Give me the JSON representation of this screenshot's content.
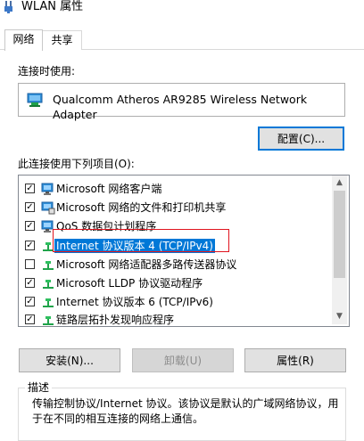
{
  "window": {
    "title": "WLAN 属性",
    "icon": "network-adapter-icon"
  },
  "tabs": [
    {
      "label": "网络",
      "active": true
    },
    {
      "label": "共享",
      "active": false
    }
  ],
  "connect_using": {
    "label": "连接时使用:",
    "adapter_name": "Qualcomm Atheros AR9285 Wireless Network Adapter",
    "configure_label": "配置(C)..."
  },
  "items_section": {
    "label": "此连接使用下列项目(O):",
    "items": [
      {
        "label": "Microsoft 网络客户端",
        "checked": true,
        "icon": "network-client-icon"
      },
      {
        "label": "Microsoft 网络的文件和打印机共享",
        "checked": true,
        "icon": "file-printer-share-icon"
      },
      {
        "label": "QoS 数据包计划程序",
        "checked": true,
        "icon": "qos-icon"
      },
      {
        "label": "Internet 协议版本 4 (TCP/IPv4)",
        "checked": true,
        "icon": "protocol-icon",
        "selected": true
      },
      {
        "label": "Microsoft 网络适配器多路传送器协议",
        "checked": false,
        "icon": "protocol-icon"
      },
      {
        "label": "Microsoft LLDP 协议驱动程序",
        "checked": true,
        "icon": "protocol-icon"
      },
      {
        "label": "Internet 协议版本 6 (TCP/IPv6)",
        "checked": true,
        "icon": "protocol-icon"
      },
      {
        "label": "链路层拓扑发现响应程序",
        "checked": true,
        "icon": "protocol-icon"
      }
    ]
  },
  "buttons": {
    "install": "安装(N)...",
    "uninstall": "卸载(U)",
    "properties": "属性(R)"
  },
  "description": {
    "title": "描述",
    "text": "传输控制协议/Internet 协议。该协议是默认的广域网络协议，用于在不同的相互连接的网络上通信。"
  },
  "colors": {
    "selection": "#0078d7",
    "highlight_outline": "#e0141e",
    "button_bg": "#e1e1e1"
  }
}
